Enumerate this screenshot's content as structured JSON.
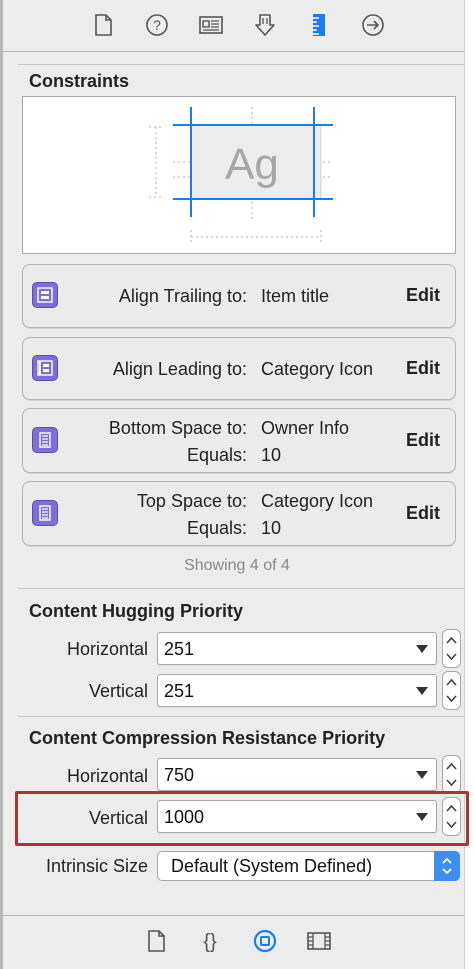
{
  "toolbar": {
    "icons": [
      "file-icon",
      "help-icon",
      "identity-icon",
      "attributes-icon",
      "size-ruler-icon",
      "connections-icon"
    ],
    "selected_icon": "size-ruler-icon",
    "accent": "#1b7cf0"
  },
  "constraints": {
    "title": "Constraints",
    "preview_text": "Ag",
    "items": [
      {
        "label_line1": "Align Trailing to:",
        "value_line1": "Item title",
        "edit": "Edit"
      },
      {
        "label_line1": "Align Leading to:",
        "value_line1": "Category Icon",
        "edit": "Edit"
      },
      {
        "label_line1": "Bottom Space to:",
        "value_line1": "Owner Info",
        "label_line2": "Equals:",
        "value_line2": "10",
        "edit": "Edit"
      },
      {
        "label_line1": "Top Space to:",
        "value_line1": "Category Icon",
        "label_line2": "Equals:",
        "value_line2": "10",
        "edit": "Edit"
      }
    ],
    "showing": "Showing 4 of 4",
    "icon_color": "#7e6fd8"
  },
  "hugging": {
    "title": "Content Hugging Priority",
    "horizontal_label": "Horizontal",
    "horizontal_value": "251",
    "vertical_label": "Vertical",
    "vertical_value": "251"
  },
  "compression": {
    "title": "Content Compression Resistance Priority",
    "horizontal_label": "Horizontal",
    "horizontal_value": "750",
    "vertical_label": "Vertical",
    "vertical_value": "1000",
    "highlight_color": "#b3312e"
  },
  "intrinsic": {
    "label": "Intrinsic Size",
    "value": "Default (System Defined)"
  },
  "bottombar": {
    "icons": [
      "file-template-icon",
      "code-snippet-icon",
      "object-library-icon",
      "media-library-icon"
    ],
    "selected_icon": "object-library-icon"
  }
}
